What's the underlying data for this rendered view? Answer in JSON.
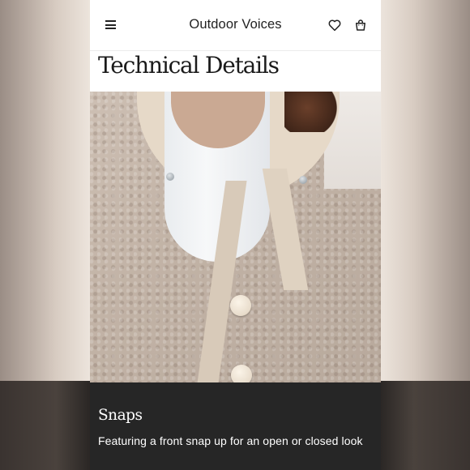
{
  "header": {
    "brand": "Outdoor Voices",
    "menu_icon": "hamburger-menu-icon",
    "wishlist_icon": "heart-icon",
    "cart_icon": "shopping-bag-icon"
  },
  "section": {
    "title": "Technical Details"
  },
  "feature": {
    "title": "Snaps",
    "description": "Featuring a front snap up for an open or closed look"
  },
  "colors": {
    "caption_background": "#262626",
    "page_background": "#ffffff",
    "text_dark": "#1a1a1a"
  }
}
